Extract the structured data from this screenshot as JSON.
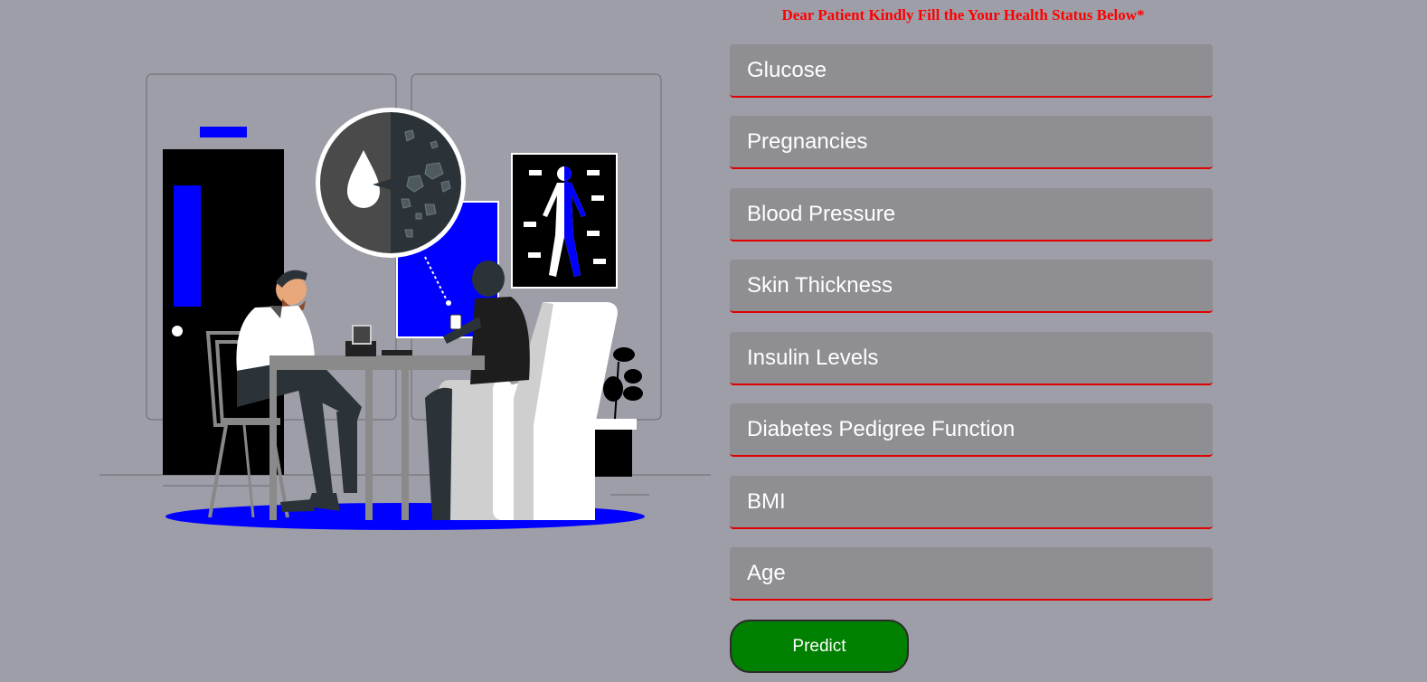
{
  "form": {
    "heading": "Dear Patient Kindly Fill the Your Health Status Below*",
    "fields": [
      {
        "placeholder": "Glucose"
      },
      {
        "placeholder": "Pregnancies"
      },
      {
        "placeholder": "Blood Pressure"
      },
      {
        "placeholder": "Skin Thickness"
      },
      {
        "placeholder": "Insulin Levels"
      },
      {
        "placeholder": "Diabetes Pedigree Function"
      },
      {
        "placeholder": "BMI"
      },
      {
        "placeholder": "Age"
      }
    ],
    "submit_label": "Predict"
  },
  "colors": {
    "background": "#9e9ea8",
    "field_bg": "#8f8e93",
    "field_underline": "#e00000",
    "heading": "#ff0000",
    "button_bg": "#008000",
    "accent_blue": "#0000ff"
  },
  "illustration": {
    "icon": "doctor-consultation-illustration"
  }
}
